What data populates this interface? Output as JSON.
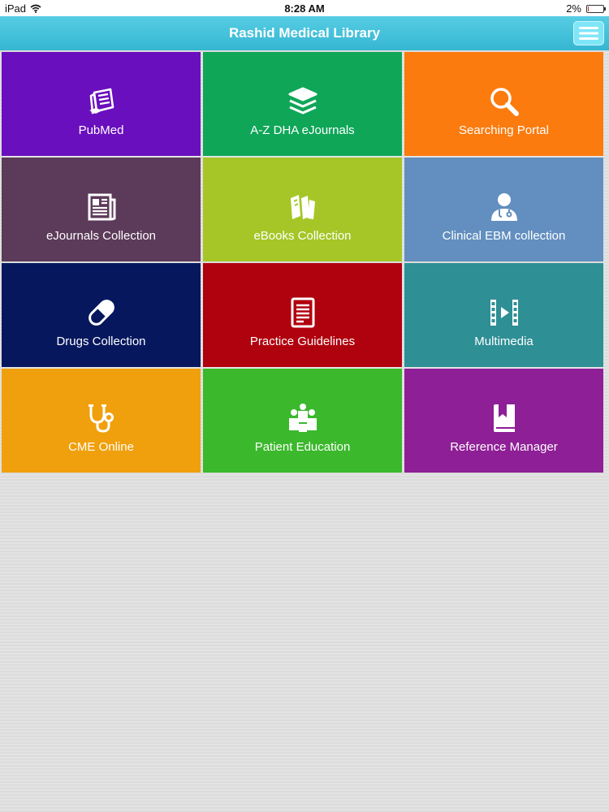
{
  "status_bar": {
    "device": "iPad",
    "time": "8:28 AM",
    "battery_percent": "2%",
    "battery_level": 0.02
  },
  "header": {
    "title": "Rashid Medical Library",
    "menu_icon": "hamburger-menu-icon"
  },
  "colors": {
    "header_top": "#56cde4",
    "header_bottom": "#36b6d2",
    "menu_button": "#7fe6f7"
  },
  "tiles": [
    {
      "label": "PubMed",
      "icon": "pubmed-icon",
      "color": "#6a0fbd"
    },
    {
      "label": "A-Z DHA eJournals",
      "icon": "journals-stack-icon",
      "color": "#0fa658"
    },
    {
      "label": "Searching Portal",
      "icon": "search-icon",
      "color": "#fb7b0e"
    },
    {
      "label": "eJournals Collection",
      "icon": "newspaper-icon",
      "color": "#5c3a59"
    },
    {
      "label": "eBooks Collection",
      "icon": "books-icon",
      "color": "#a5c626"
    },
    {
      "label": "Clinical EBM collection",
      "icon": "doctor-icon",
      "color": "#628fbf"
    },
    {
      "label": "Drugs Collection",
      "icon": "pill-icon",
      "color": "#06175e"
    },
    {
      "label": "Practice Guidelines",
      "icon": "document-icon",
      "color": "#b0010e"
    },
    {
      "label": "Multimedia",
      "icon": "film-icon",
      "color": "#2e8f95"
    },
    {
      "label": "CME Online",
      "icon": "stethoscope-icon",
      "color": "#f0a00c"
    },
    {
      "label": "Patient Education",
      "icon": "people-icon",
      "color": "#3bb82c"
    },
    {
      "label": "Reference Manager",
      "icon": "bookmark-book-icon",
      "color": "#8e1f96"
    }
  ]
}
